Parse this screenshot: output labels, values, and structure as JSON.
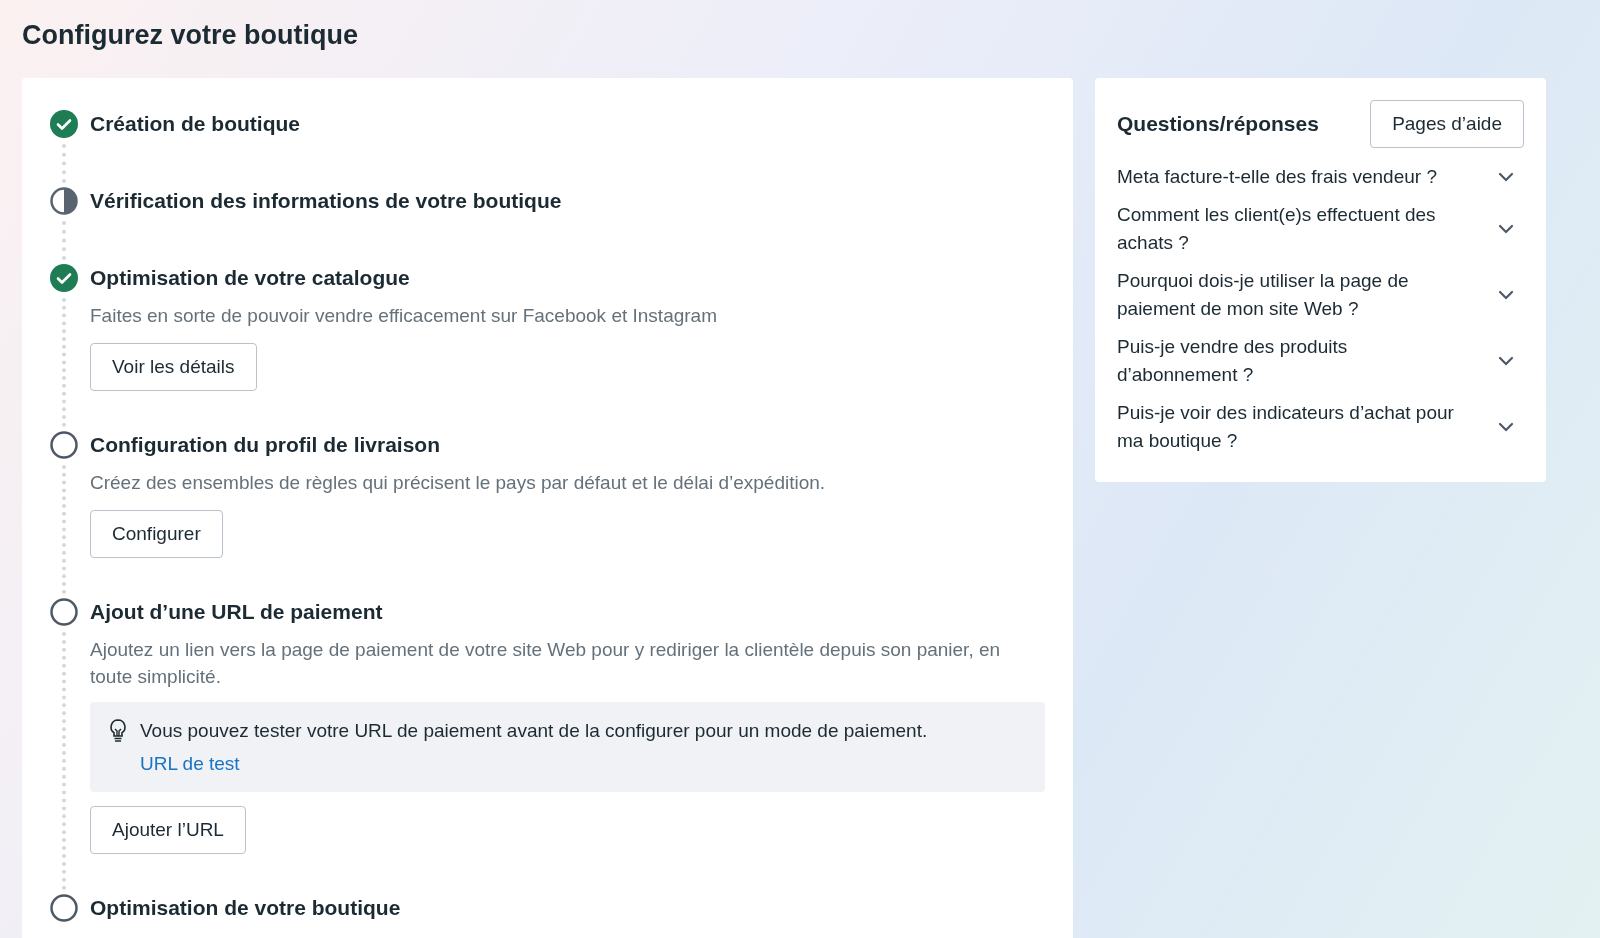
{
  "page_title": "Configurez votre boutique",
  "steps": [
    {
      "title": "Création de boutique",
      "kind": "done"
    },
    {
      "title": "Vérification des informations de votre boutique",
      "kind": "partial"
    },
    {
      "title": "Optimisation de votre catalogue",
      "kind": "done",
      "description": "Faites en sorte de pouvoir vendre efficacement sur Facebook et Instagram",
      "button": "Voir les détails"
    },
    {
      "title": "Configuration du profil de livraison",
      "kind": "todo",
      "description": "Créez des ensembles de règles qui précisent le pays par défaut et le délai d’expédition.",
      "button": "Configurer"
    },
    {
      "title": "Ajout d’une URL de paiement",
      "kind": "todo",
      "description": "Ajoutez un lien vers la page de paiement de votre site Web pour y rediriger la clientèle depuis son panier, en toute simplicité.",
      "tip": {
        "text": "Vous pouvez tester votre URL de paiement avant de la configurer pour un mode de paiement.",
        "link": "URL de test"
      },
      "button": "Ajouter l’URL"
    },
    {
      "title": "Optimisation de votre boutique",
      "kind": "todo"
    }
  ],
  "faq": {
    "title": "Questions/réponses",
    "button": "Pages d’aide",
    "items": [
      {
        "question": "Meta facture-t-elle des frais vendeur ?",
        "expanded": false
      },
      {
        "question": "Comment les client(e)s effectuent des achats ?",
        "expanded": false
      },
      {
        "question": "Pourquoi dois-je utiliser la page de paiement de mon site Web ?",
        "expanded": false
      },
      {
        "question": "Puis-je vendre des produits d’abonnement ?",
        "expanded": false
      },
      {
        "question": "Puis-je voir des indicateurs d’achat pour ma boutique ?",
        "expanded": false
      }
    ]
  }
}
